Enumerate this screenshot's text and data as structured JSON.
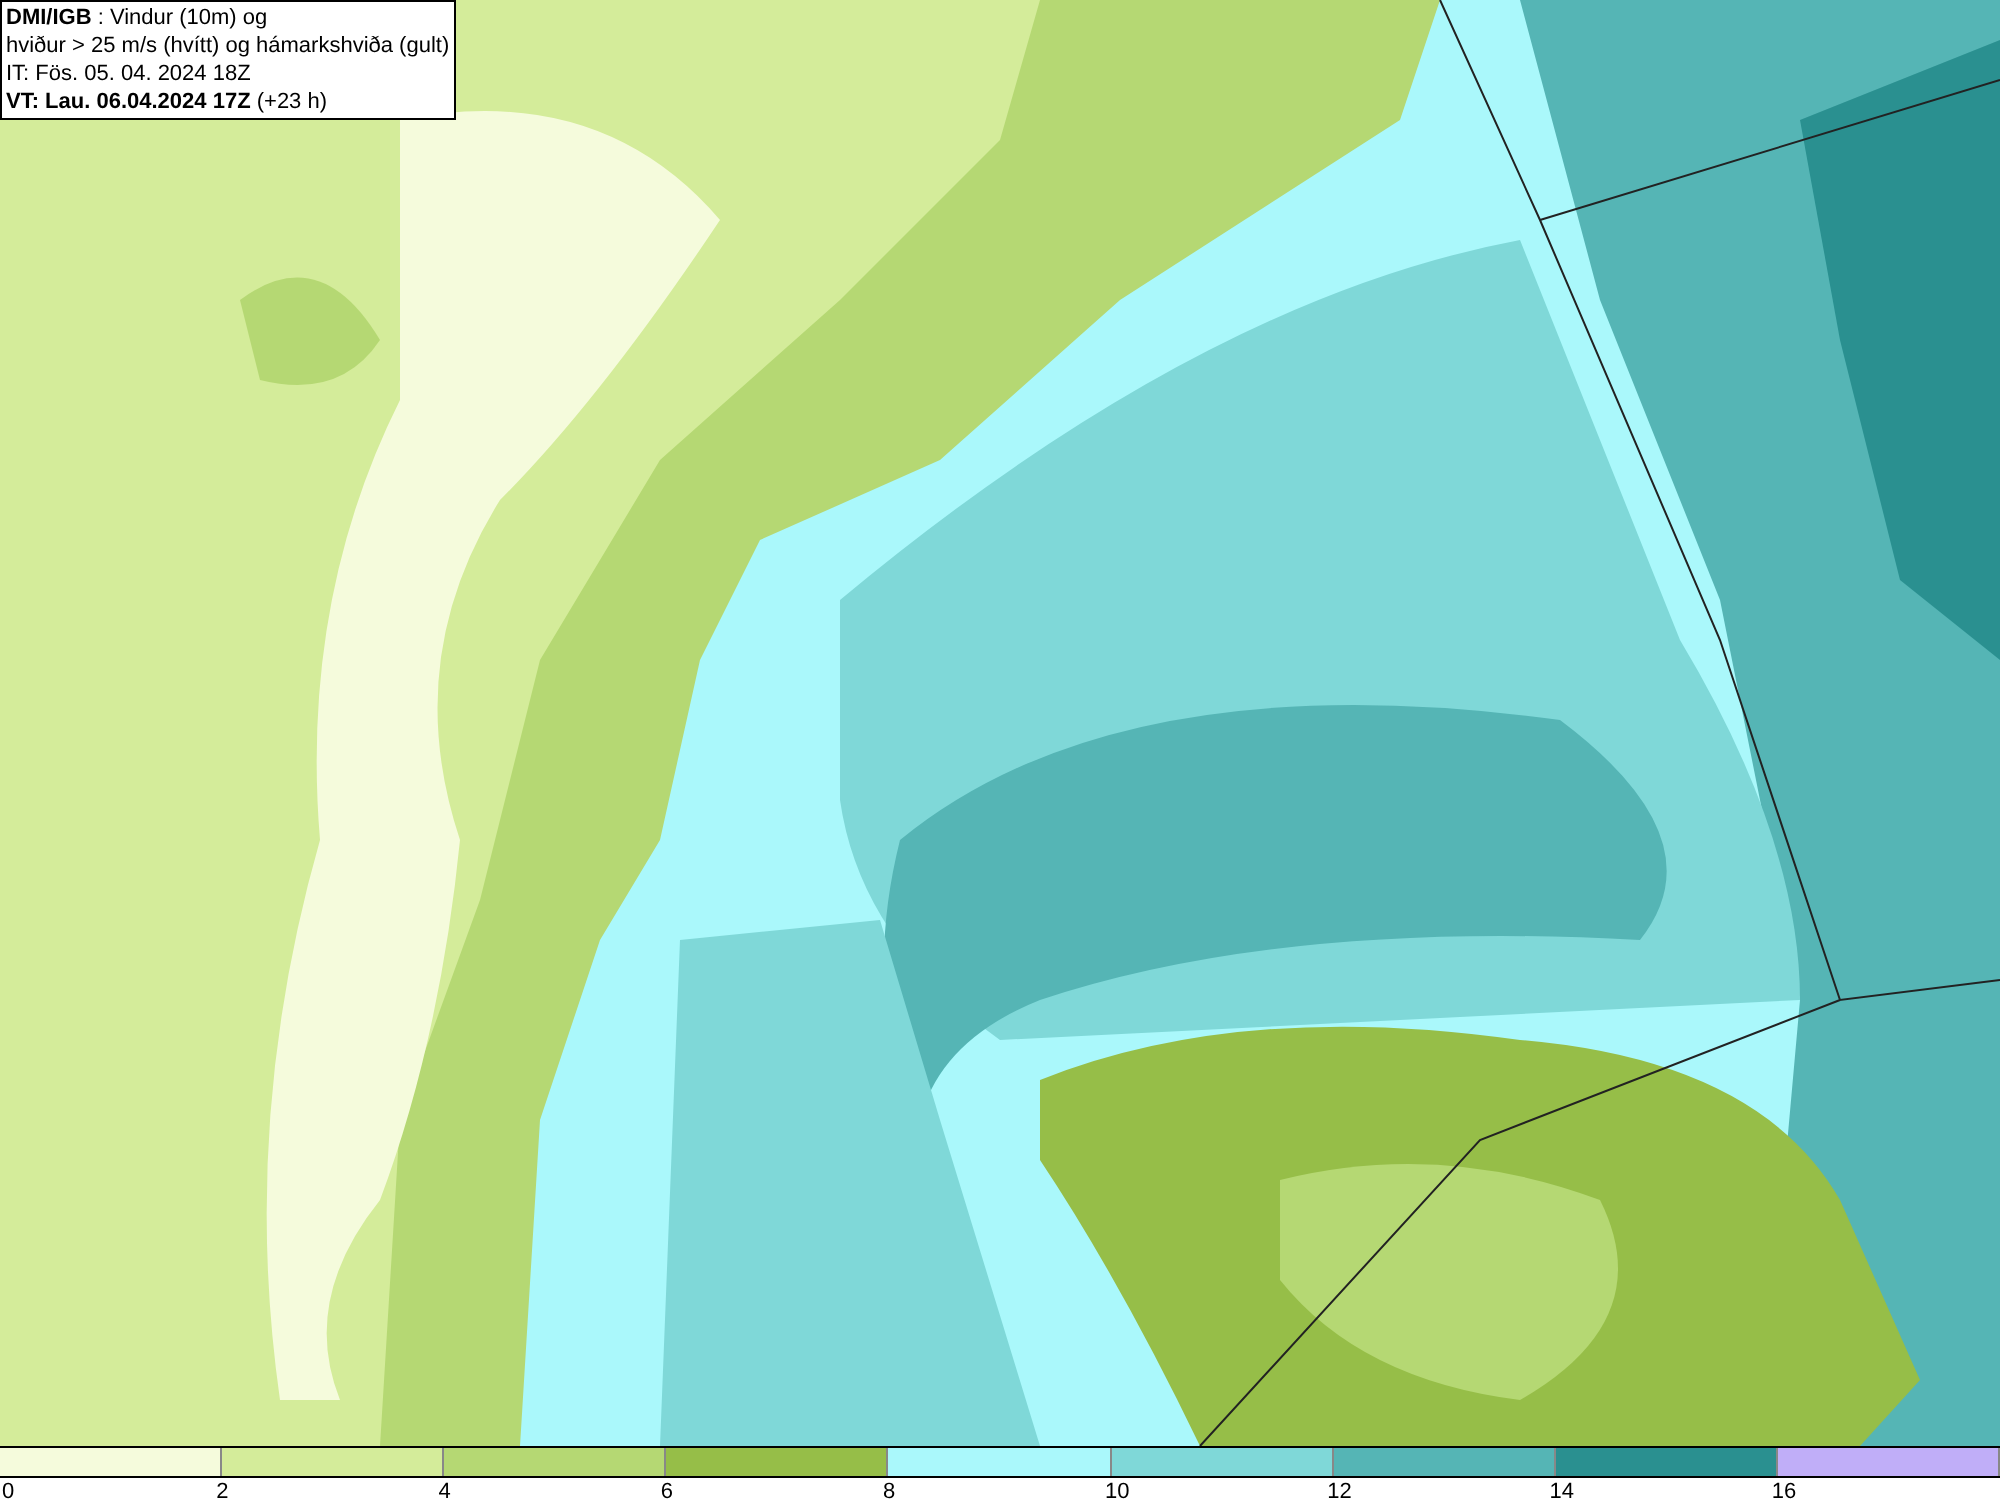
{
  "title_box": {
    "lines": [
      "**DMI/IGB** : Vindur (10m) og",
      "hviður > 25 m/s (hvítt) og hámarkshviða (gult)",
      "IT: Fös. 05. 04. 2024 18Z",
      "**VT: Lau. 06.04.2024 17Z** (+23 h)"
    ]
  },
  "legend": {
    "bands": [
      {
        "color": "#f5fbdc"
      },
      {
        "color": "#d4ec9a"
      },
      {
        "color": "#b5d873"
      },
      {
        "color": "#96be48"
      },
      {
        "color": "#aaf8fb"
      },
      {
        "color": "#7fd8d8"
      },
      {
        "color": "#55b5b5"
      },
      {
        "color": "#2a9090"
      },
      {
        "color": "#c0aef8"
      }
    ],
    "ticks": [
      "0",
      "2",
      "4",
      "6",
      "8",
      "10",
      "12",
      "14",
      "16"
    ]
  }
}
